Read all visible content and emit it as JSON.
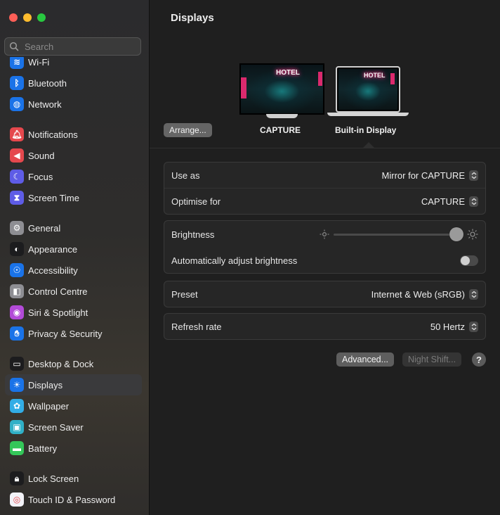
{
  "window": {
    "title": "Displays"
  },
  "search": {
    "placeholder": "Search"
  },
  "sidebar": {
    "partial_item": "Wi-Fi",
    "items": [
      {
        "label": "Bluetooth",
        "icon": "bluetooth-icon",
        "color": "#1a73e8"
      },
      {
        "label": "Network",
        "icon": "globe-icon",
        "color": "#1a73e8"
      },
      {
        "label": "Notifications",
        "icon": "bell-icon",
        "color": "#e5484d"
      },
      {
        "label": "Sound",
        "icon": "speaker-icon",
        "color": "#e5484d"
      },
      {
        "label": "Focus",
        "icon": "moon-icon",
        "color": "#5e5ce6"
      },
      {
        "label": "Screen Time",
        "icon": "hourglass-icon",
        "color": "#5e5ce6"
      },
      {
        "label": "General",
        "icon": "gear-icon",
        "color": "#8e8e93"
      },
      {
        "label": "Appearance",
        "icon": "appearance-icon",
        "color": "#1c1c1e"
      },
      {
        "label": "Accessibility",
        "icon": "accessibility-icon",
        "color": "#1a73e8"
      },
      {
        "label": "Control Centre",
        "icon": "toggles-icon",
        "color": "#8e8e93"
      },
      {
        "label": "Siri & Spotlight",
        "icon": "siri-icon",
        "color": "#b34bd8"
      },
      {
        "label": "Privacy & Security",
        "icon": "hand-icon",
        "color": "#1a73e8"
      },
      {
        "label": "Desktop & Dock",
        "icon": "dock-icon",
        "color": "#1c1c1e"
      },
      {
        "label": "Displays",
        "icon": "sun-icon",
        "color": "#1a73e8"
      },
      {
        "label": "Wallpaper",
        "icon": "flower-icon",
        "color": "#32ade6"
      },
      {
        "label": "Screen Saver",
        "icon": "screensaver-icon",
        "color": "#30b0c7"
      },
      {
        "label": "Battery",
        "icon": "battery-icon",
        "color": "#34c759"
      },
      {
        "label": "Lock Screen",
        "icon": "lock-icon",
        "color": "#1c1c1e"
      },
      {
        "label": "Touch ID & Password",
        "icon": "fingerprint-icon",
        "color": "#f2f2f7"
      }
    ],
    "selected": "Displays"
  },
  "monitors": {
    "arrange_label": "Arrange...",
    "external_label": "CAPTURE",
    "builtin_label": "Built-in Display",
    "wallpaper_text": "HOTEL"
  },
  "settings": {
    "use_as_label": "Use as",
    "use_as_value": "Mirror for CAPTURE",
    "optimise_label": "Optimise for",
    "optimise_value": "CAPTURE",
    "brightness_label": "Brightness",
    "brightness_level": 0.95,
    "auto_brightness_label": "Automatically adjust brightness",
    "auto_brightness_on": false,
    "preset_label": "Preset",
    "preset_value": "Internet & Web (sRGB)",
    "refresh_label": "Refresh rate",
    "refresh_value": "50 Hertz"
  },
  "footer": {
    "advanced_label": "Advanced...",
    "nightshift_label": "Night Shift...",
    "help_label": "?"
  }
}
